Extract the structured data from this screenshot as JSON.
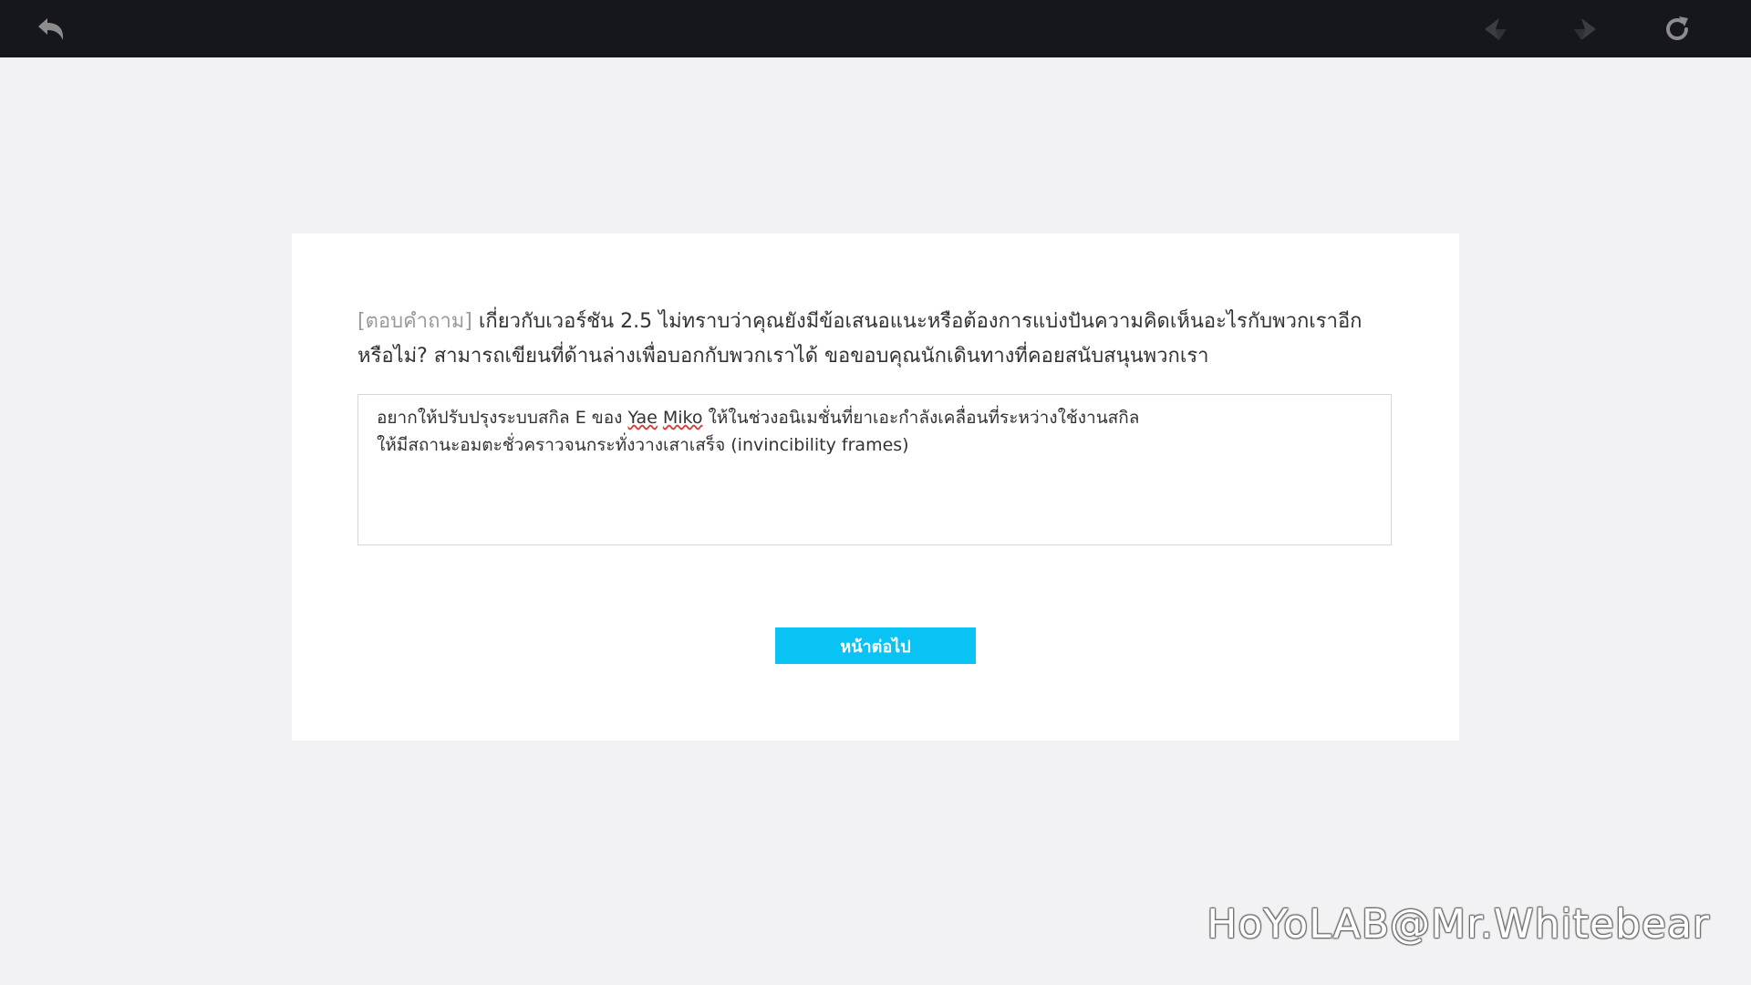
{
  "toolbar": {
    "back_icon": "back-arrow-icon",
    "prev_icon": "prev-arrow-icon",
    "next_icon": "next-arrow-icon",
    "refresh_icon": "refresh-icon",
    "background_color": "#16171d",
    "active_icon_color": "#8c8c8c",
    "disabled_icon_color": "#3b3c42"
  },
  "survey": {
    "question_tag": "[ตอบคำถาม]",
    "question_text": " เกี่ยวกับเวอร์ชัน 2.5 ไม่ทราบว่าคุณยังมีข้อเสนอแนะหรือต้องการแบ่งปันความคิดเห็นอะไรกับพวกเราอีกหรือไม่? สามารถเขียนที่ด้านล่างเพื่อบอกกับพวกเราได้ ขอขอบคุณนักเดินทางที่คอยสนับสนุนพวกเรา",
    "answer": {
      "line1_prefix": "อยากให้ปรับปรุงระบบสกิล E ของ ",
      "line1_word1": "Yae",
      "line1_space": " ",
      "line1_word2": "Miko",
      "line1_suffix": " ให้ในช่วงอนิเมชั่นที่ยาเอะกำลังเคลื่อนที่ระหว่างใช้งานสกิล",
      "line2": "ให้มีสถานะอมตะชั่วคราวจนกระทั่งวางเสาเสร็จ (invincibility frames)"
    },
    "next_button_label": "หน้าต่อไป",
    "next_button_color": "#09c3f5"
  },
  "watermark": "HoYoLAB@Mr.Whitebear"
}
